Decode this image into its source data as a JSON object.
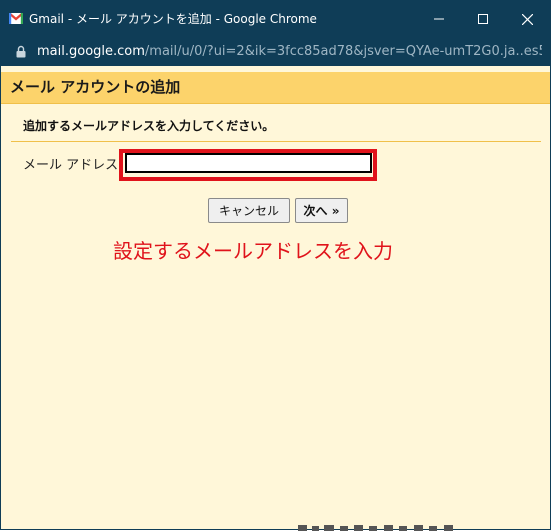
{
  "window": {
    "title": "Gmail - メール アカウントを追加 - Google Chrome",
    "app_icon": "gmail-icon",
    "controls": [
      "minimize-icon",
      "maximize-icon",
      "close-icon"
    ],
    "title_bar_color": "#0f3d57"
  },
  "address_bar": {
    "host": "mail.google.com",
    "path": "/mail/u/0/?ui=2&ik=3fcc85ad78&jsver=QYAe-umT2G0.ja..es5..."
  },
  "dialog": {
    "header_title": "メール アカウントの追加",
    "instruction": "追加するメールアドレスを入力してください。",
    "email_label": "メール アドレス",
    "email_value": "",
    "cancel_label": "キャンセル",
    "next_label": "次へ »",
    "annotation": "設定するメールアドレスを入力",
    "header_color": "#fcd36b",
    "background_color": "#fff7d9",
    "highlight_color": "#e0131b"
  }
}
